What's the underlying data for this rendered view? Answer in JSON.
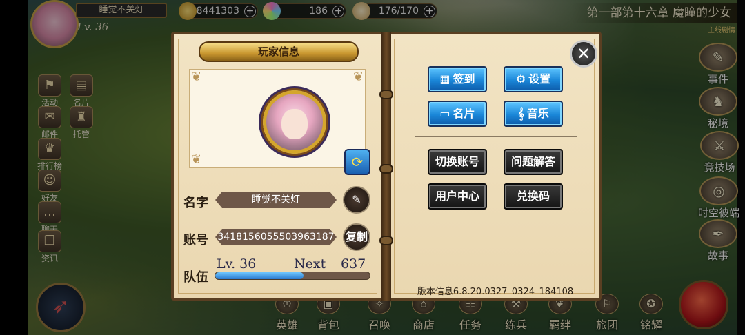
{
  "hud": {
    "player_name": "睡觉不关灯",
    "level": "Lv. 36",
    "gold": "8441303",
    "gems": "186",
    "stamina": "176/170",
    "chapter_title": "第一部第十六章 魔瞳的少女",
    "chapter_sub": "主线剧情"
  },
  "left_icons": [
    {
      "label": "活动",
      "icon": "flag-icon"
    },
    {
      "label": "名片",
      "icon": "card-icon"
    },
    {
      "label": "邮件",
      "icon": "mail-icon"
    },
    {
      "label": "托管",
      "icon": "auto-icon"
    },
    {
      "label": "排行榜",
      "icon": "crown-icon"
    },
    {
      "label": "好友",
      "icon": "friend-icon"
    },
    {
      "label": "聊天",
      "icon": "chat-icon"
    },
    {
      "label": "资讯",
      "icon": "book-icon"
    }
  ],
  "right_icons": [
    {
      "label": "事件",
      "icon": "scroll-icon"
    },
    {
      "label": "秘境",
      "icon": "statue-icon"
    },
    {
      "label": "竞技场",
      "icon": "swords-icon"
    },
    {
      "label": "时空彼端",
      "icon": "portal-icon"
    },
    {
      "label": "故事",
      "icon": "quill-icon"
    }
  ],
  "bottom_bar": [
    "英雄",
    "背包",
    "召唤",
    "商店",
    "任务",
    "练兵",
    "羁绊",
    "旅团",
    "铭耀"
  ],
  "dialog": {
    "title": "玩家信息",
    "name_label": "名字",
    "name_value": "睡觉不关灯",
    "account_label": "账号",
    "account_value": "3418156055503963187",
    "copy_label": "复制",
    "team_label": "队伍",
    "team_level": "Lv. 36",
    "next_label": "Next",
    "next_value": "637",
    "exp_progress": 0.57,
    "close_glyph": "✕",
    "buttons": {
      "signin": "签到",
      "settings": "设置",
      "namecard": "名片",
      "music": "音乐",
      "switch_account": "切换账号",
      "faq": "问题解答",
      "user_center": "用户中心",
      "redeem": "兑换码"
    },
    "version": "版本信息6.8.20.0327_0324_184108"
  }
}
